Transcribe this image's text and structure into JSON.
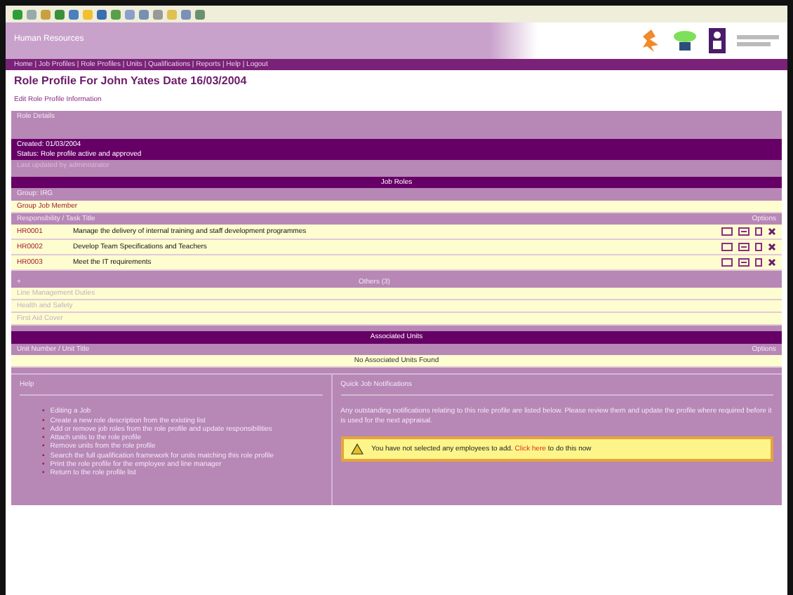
{
  "site": {
    "name": "Human Resources",
    "nav": "Home | Job Profiles | Role Profiles | Units | Qualifications | Reports | Help | Logout"
  },
  "page": {
    "title": "Role Profile For John Yates Date 16/03/2004",
    "link": "Edit Role Profile Information"
  },
  "role_details": {
    "heading": "Role Details",
    "lines": [
      "Created: 01/03/2004",
      "Status: Role profile active and approved"
    ],
    "note": "Last updated by administrator"
  },
  "job_roles": {
    "heading": "Job Roles",
    "group": "Group: IRG",
    "member": "Group Job Member",
    "columns": [
      "Responsibility / Task Title",
      "Options"
    ],
    "rows": [
      {
        "code": "HR0001",
        "title": "Manage the delivery of internal training and staff development programmes"
      },
      {
        "code": "HR0002",
        "title": "Develop Team Specifications and Teachers"
      },
      {
        "code": "HR0003",
        "title": "Meet the IT requirements"
      }
    ]
  },
  "others": {
    "left": "+",
    "heading": "Others (3)",
    "rows": [
      "Line Management Duties",
      "Health and Safety",
      "First Aid Cover"
    ]
  },
  "units": {
    "heading": "Associated Units",
    "columns": [
      "Unit Number / Unit Title",
      "Options"
    ],
    "empty": "No Associated Units Found"
  },
  "help": {
    "heading": "Help",
    "marker": "•",
    "items": [
      "Editing a Job",
      "Create a new role description from the existing list",
      "Add or remove job roles from the role profile and update responsibilities",
      "Attach units to the role profile",
      "Remove units from the role profile",
      "Search the full qualification framework for units matching this role profile",
      "Print the role profile for the employee and line manager",
      "Return to the role profile list"
    ]
  },
  "notifications": {
    "heading": "Quick Job Notifications",
    "text": "Any outstanding notifications relating to this role profile are listed below. Please review them and update the profile where required before it is used for the next appraisal.",
    "warning": {
      "before": "You have not selected any employees to add.",
      "link": "Click here",
      "after": "to do this now"
    }
  }
}
